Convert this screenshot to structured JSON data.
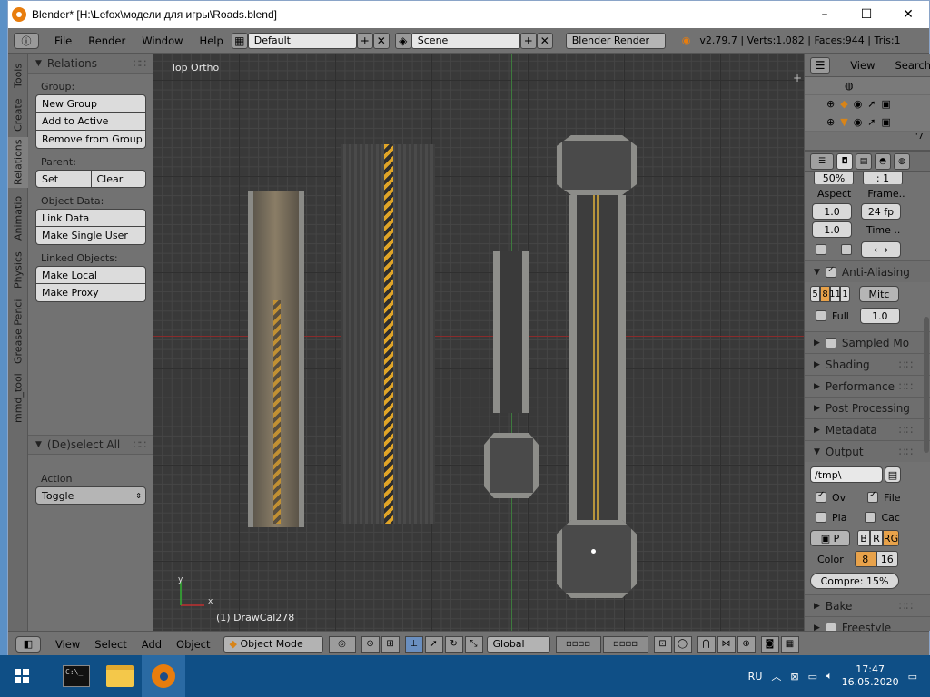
{
  "titlebar": {
    "title": "Blender* [H:\\Lefox\\модели для игры\\Roads.blend]",
    "minimize": "–",
    "maximize": "☐",
    "close": "✕"
  },
  "menubar": {
    "items": [
      "File",
      "Render",
      "Window",
      "Help"
    ],
    "layout": "Default",
    "scene": "Scene",
    "engine": "Blender Render",
    "stats": "v2.79.7 | Verts:1,082 | Faces:944 | Tris:1"
  },
  "sidetabs": [
    "Tools",
    "Create",
    "Relations",
    "Animatio",
    "Physics",
    "Grease Penci",
    "mmd_tool"
  ],
  "toolpanel": {
    "relations_header": "Relations",
    "group_label": "Group:",
    "new_group": "New Group",
    "add_to_active": "Add to Active",
    "remove_from_group": "Remove from Group",
    "parent_label": "Parent:",
    "set": "Set",
    "clear": "Clear",
    "object_data_label": "Object Data:",
    "link_data": "Link Data",
    "make_single_user": "Make Single User",
    "linked_objects_label": "Linked Objects:",
    "make_local": "Make Local",
    "make_proxy": "Make Proxy",
    "deselect_header": "(De)select All",
    "action_label": "Action",
    "action_value": "Toggle"
  },
  "viewport": {
    "view_label": "Top Ortho",
    "object_label": "(1) DrawCal278",
    "gizmo_x": "x",
    "gizmo_y": "y"
  },
  "bottombar": {
    "items": [
      "View",
      "Select",
      "Add",
      "Object"
    ],
    "mode": "Object Mode",
    "orientation": "Global"
  },
  "outliner": {
    "view": "View",
    "search": "Search",
    "count": "'7"
  },
  "properties": {
    "cut_top_1": "50%",
    "cut_top_2": ": 1",
    "aspect_label": "Aspect",
    "aspect_x": "1.0",
    "aspect_y": "1.0",
    "frame_label": "Frame..",
    "fps": "24 fp",
    "time_label": "Time ..",
    "aa_header": "Anti-Aliasing",
    "aa_samples": [
      "5",
      "8",
      "11",
      "1"
    ],
    "aa_filter": "Mitc",
    "full_label": "Full",
    "full_value": "1.0",
    "sections": [
      "Sampled Mo",
      "Shading",
      "Performance",
      "Post Processing",
      "Metadata",
      "Output"
    ],
    "output_path": "/tmp\\",
    "ov": "Ov",
    "file": "File",
    "pla": "Pla",
    "cac": "Cac",
    "format_p": "P",
    "bw": "B",
    "r": "R",
    "rgb": "RG",
    "color_label": "Color",
    "depth_8": "8",
    "depth_16": "16",
    "compress": "Compre: 15%",
    "bake": "Bake",
    "freestyle": "Freestyle"
  },
  "taskbar": {
    "lang": "RU",
    "time": "17:47",
    "date": "16.05.2020"
  }
}
